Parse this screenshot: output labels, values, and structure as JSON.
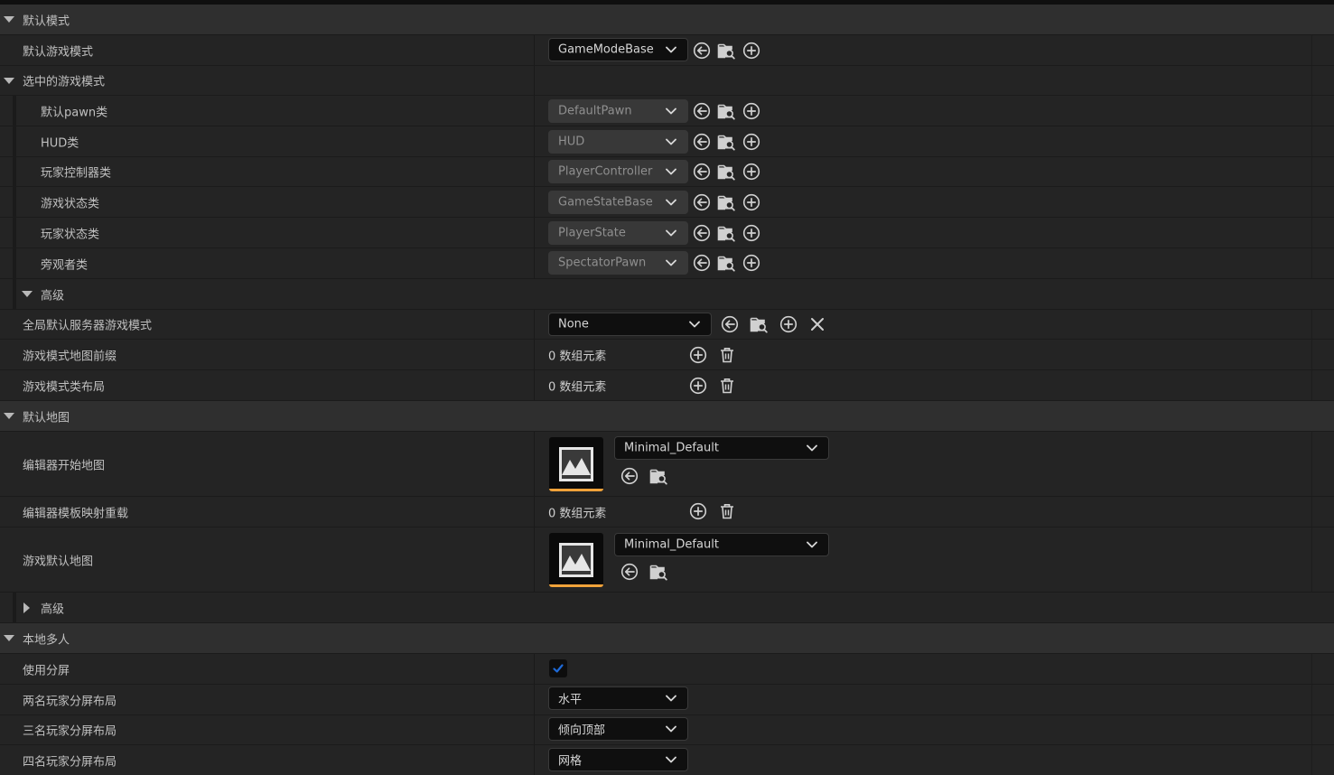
{
  "sections": {
    "default_modes": {
      "title": "默认模式",
      "default_game_mode": {
        "label": "默认游戏模式",
        "value": "GameModeBase"
      },
      "selected_game_mode": {
        "title": "选中的游戏模式",
        "pawn": {
          "label": "默认pawn类",
          "value": "DefaultPawn"
        },
        "hud": {
          "label": "HUD类",
          "value": "HUD"
        },
        "player_controller": {
          "label": "玩家控制器类",
          "value": "PlayerController"
        },
        "game_state": {
          "label": "游戏状态类",
          "value": "GameStateBase"
        },
        "player_state": {
          "label": "玩家状态类",
          "value": "PlayerState"
        },
        "spectator": {
          "label": "旁观者类",
          "value": "SpectatorPawn"
        }
      },
      "advanced": {
        "title": "高级",
        "global_server_mode": {
          "label": "全局默认服务器游戏模式",
          "value": "None"
        },
        "map_prefixes": {
          "label": "游戏模式地图前缀",
          "value": "0 数组元素"
        },
        "class_aliases": {
          "label": "游戏模式类布局",
          "value": "0 数组元素"
        }
      }
    },
    "default_maps": {
      "title": "默认地图",
      "editor_startup_map": {
        "label": "编辑器开始地图",
        "value": "Minimal_Default"
      },
      "editor_template_override": {
        "label": "编辑器模板映射重载",
        "value": "0 数组元素"
      },
      "game_default_map": {
        "label": "游戏默认地图",
        "value": "Minimal_Default"
      },
      "advanced": {
        "title": "高级"
      }
    },
    "local_multiplayer": {
      "title": "本地多人",
      "use_splitscreen": {
        "label": "使用分屏",
        "checked": true
      },
      "two_player_layout": {
        "label": "两名玩家分屏布局",
        "value": "水平"
      },
      "three_player_layout": {
        "label": "三名玩家分屏布局",
        "value": "倾向顶部"
      },
      "four_player_layout": {
        "label": "四名玩家分屏布局",
        "value": "网格"
      }
    }
  },
  "icons": [
    "arrow-left-icon",
    "browse-asset-icon",
    "add-icon",
    "clear-icon",
    "delete-icon",
    "chevron-down-icon",
    "map-thumbnail-icon",
    "checkmark-icon"
  ],
  "colors": {
    "accent": "#f0a23a",
    "check": "#1e6ad8",
    "panel": "#242424",
    "category": "#2f2f2f"
  }
}
